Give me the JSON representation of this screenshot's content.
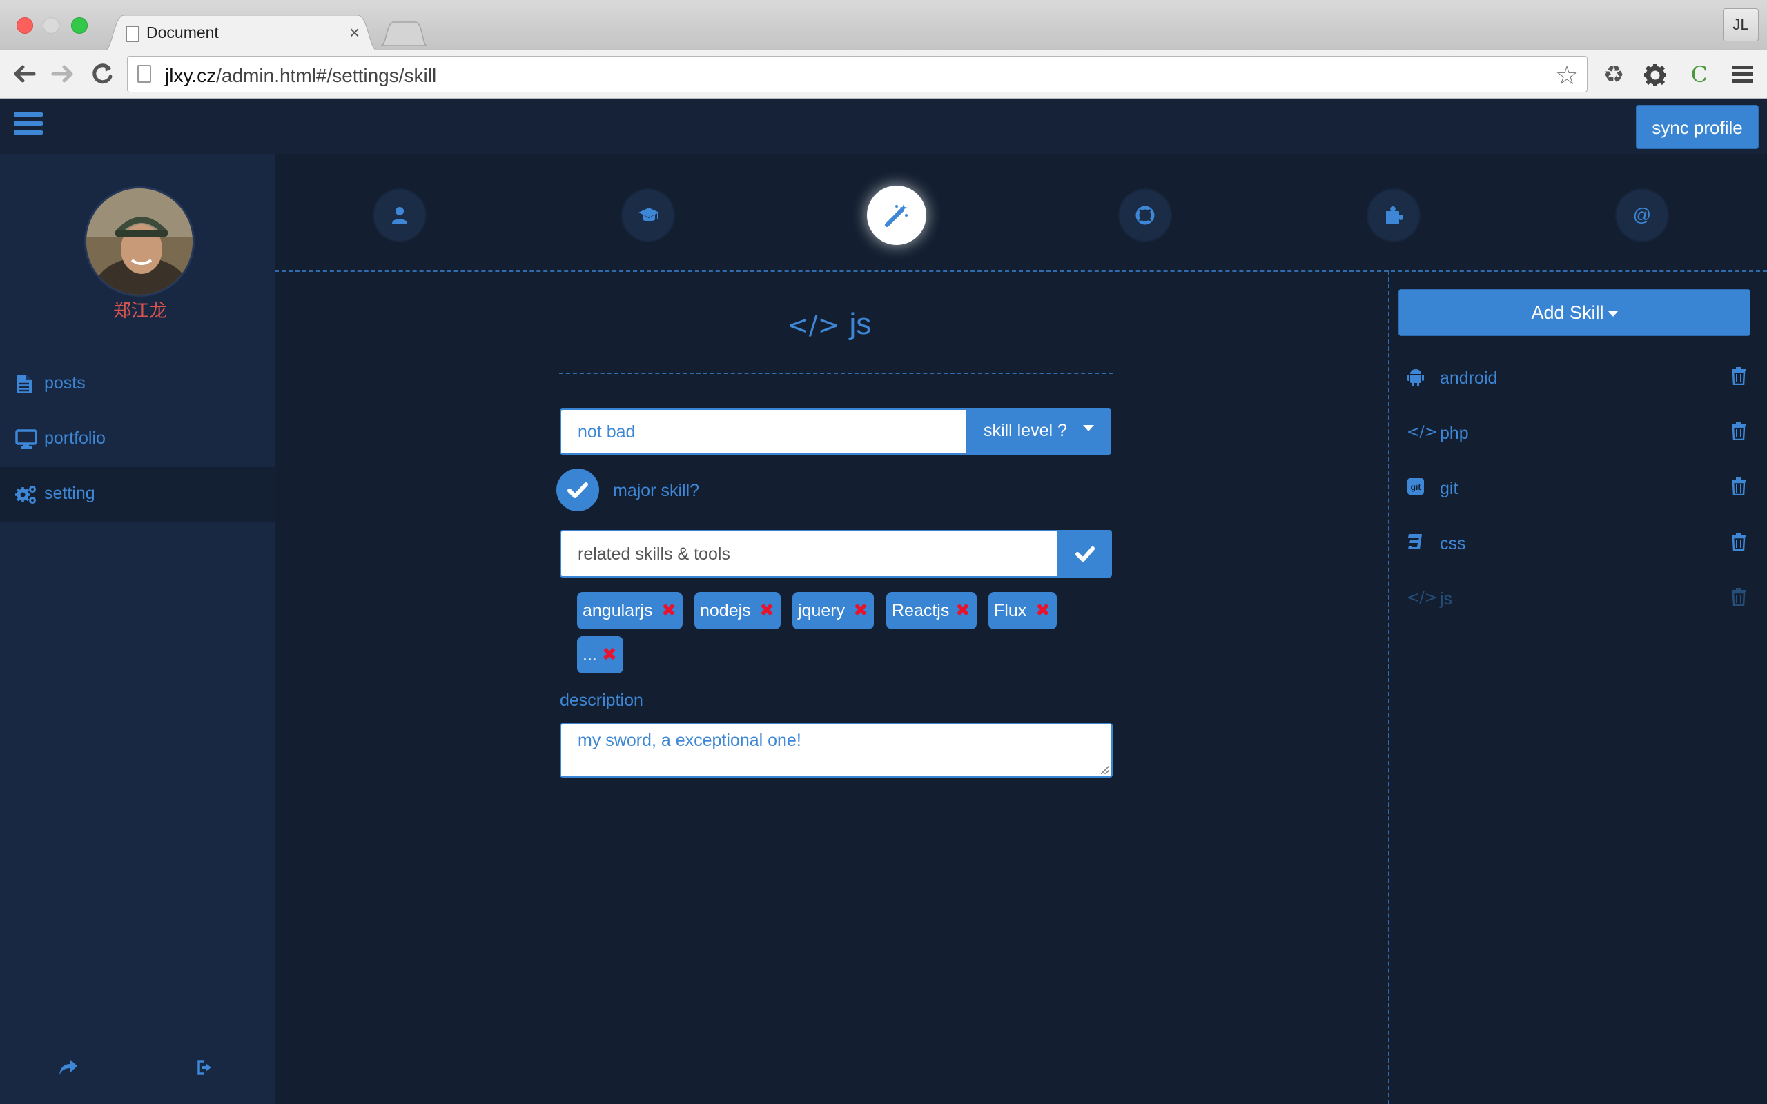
{
  "browser": {
    "tab_title": "Document",
    "tab_close": "×",
    "url_host": "jlxy.cz",
    "url_path": "/admin.html#/settings/skill",
    "profile_initials": "JL"
  },
  "header": {
    "sync_label": "sync profile"
  },
  "sidebar": {
    "username": "郑江龙",
    "items": [
      {
        "label": "posts",
        "icon": "file-text-icon"
      },
      {
        "label": "portfolio",
        "icon": "desktop-icon"
      },
      {
        "label": "setting",
        "icon": "gears-icon",
        "active": true
      }
    ],
    "bottom_icons": [
      "share-icon",
      "sign-out-icon"
    ]
  },
  "steps": [
    {
      "icon": "user-icon"
    },
    {
      "icon": "graduation-cap-icon"
    },
    {
      "icon": "magic-wand-icon",
      "active": true
    },
    {
      "icon": "life-ring-icon"
    },
    {
      "icon": "puzzle-piece-icon"
    },
    {
      "icon": "at-icon"
    }
  ],
  "form": {
    "skill_name": "js",
    "skill_icon": "code-icon",
    "level_value": "not bad",
    "level_button": "skill level ?",
    "major_label": "major skill?",
    "related_placeholder": "related skills & tools",
    "tags": [
      "angularjs",
      "nodejs",
      "jquery",
      "Reactjs",
      "Flux",
      "..."
    ],
    "description_label": "description",
    "description_value": "my sword, a exceptional one!"
  },
  "skills_panel": {
    "add_label": "Add Skill",
    "items": [
      {
        "label": "android",
        "icon": "android-icon"
      },
      {
        "label": "php",
        "icon": "code-icon"
      },
      {
        "label": "git",
        "icon": "git-square-icon"
      },
      {
        "label": "css",
        "icon": "css3-icon"
      },
      {
        "label": "js",
        "icon": "code-icon",
        "current": true
      }
    ]
  },
  "colors": {
    "background": "#131f30",
    "sidebar": "#182842",
    "accent": "#3a85d3",
    "username": "#d9534f",
    "tag_remove": "#e8132d"
  }
}
